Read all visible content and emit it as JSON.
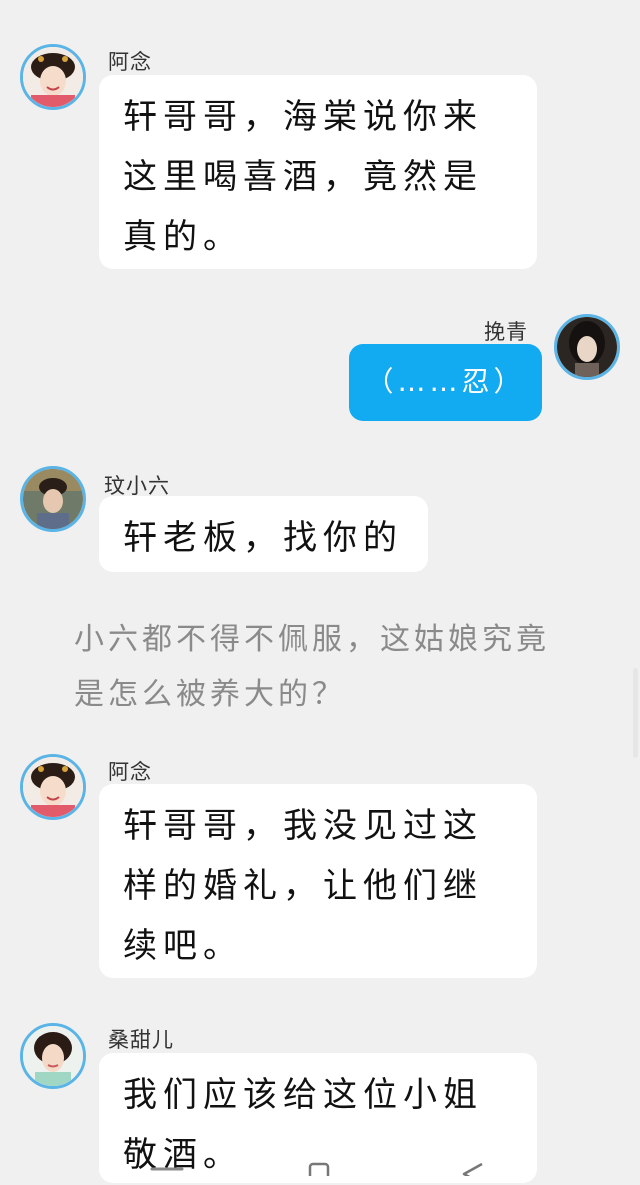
{
  "colors": {
    "background": "#f0f0f0",
    "bubble_incoming": "#ffffff",
    "bubble_outgoing": "#12aaf0",
    "avatar_ring": "#5bb4e6",
    "narration_text": "#8a8a8a"
  },
  "messages": [
    {
      "sender": "阿念",
      "text": "轩哥哥，海棠说你来这里喝喜酒，竟然是真的。"
    },
    {
      "sender": "挽青",
      "text": "（……忍）"
    },
    {
      "sender": "玟小六",
      "text": "轩老板，找你的"
    },
    {
      "sender": "阿念",
      "text": "轩哥哥，我没见过这样的婚礼，让他们继续吧。"
    },
    {
      "sender": "桑甜儿",
      "text": "我们应该给这位小姐敬酒。"
    }
  ],
  "narration": "小六都不得不佩服，这姑娘究竟是怎么被养大的？",
  "navbar_icons": [
    "home-icon",
    "recents-icon",
    "back-icon"
  ]
}
